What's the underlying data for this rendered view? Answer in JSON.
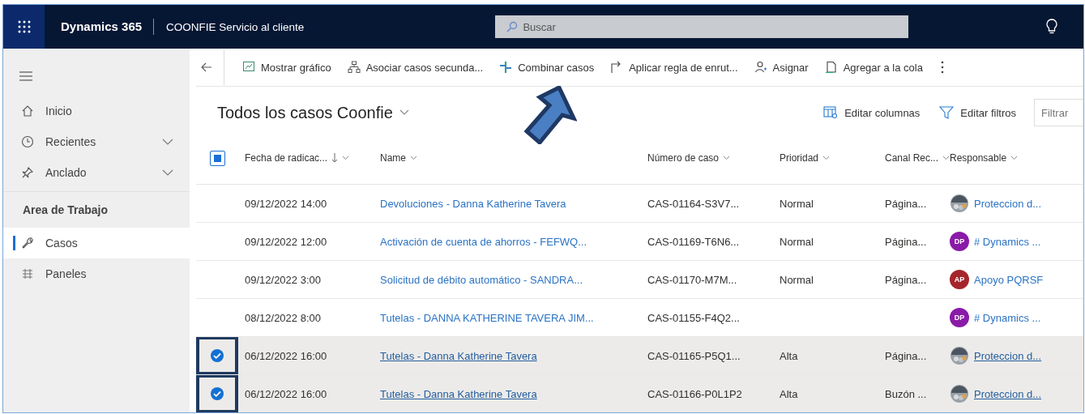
{
  "topbar": {
    "app_name": "Dynamics 365",
    "area": "COONFIE Servicio al cliente",
    "search": {
      "placeholder": "Buscar"
    }
  },
  "sidebar": {
    "items": [
      {
        "label": "Inicio",
        "kind": "home",
        "expandable": false,
        "selected": false
      },
      {
        "label": "Recientes",
        "kind": "clock",
        "expandable": true,
        "selected": false
      },
      {
        "label": "Anclado",
        "kind": "pin",
        "expandable": true,
        "selected": false
      }
    ],
    "section": "Area de Trabajo",
    "section_items": [
      {
        "label": "Casos",
        "kind": "wrench",
        "selected": true
      },
      {
        "label": "Paneles",
        "kind": "panels",
        "selected": false
      }
    ]
  },
  "commands": [
    {
      "label": "Mostrar gráfico",
      "kind": "chart"
    },
    {
      "label": "Asociar casos secunda...",
      "kind": "tree"
    },
    {
      "label": "Combinar casos",
      "kind": "merge"
    },
    {
      "label": "Aplicar regla de enrut...",
      "kind": "route"
    },
    {
      "label": "Asignar",
      "kind": "person"
    },
    {
      "label": "Agregar a la cola",
      "kind": "queue"
    }
  ],
  "view": {
    "title": "Todos los casos Coonfie",
    "actions": [
      {
        "label": "Editar columnas",
        "kind": "columns"
      },
      {
        "label": "Editar filtros",
        "kind": "filter"
      }
    ],
    "filter": {
      "placeholder": "Filtrar"
    }
  },
  "table": {
    "select_all": {
      "partial": true
    },
    "columns": [
      {
        "label": "Fecha de radicac...",
        "sorted": true
      },
      {
        "label": "Name",
        "sorted": false
      },
      {
        "label": "Número de caso",
        "sorted": false
      },
      {
        "label": "Prioridad",
        "sorted": false
      },
      {
        "label": "Canal Rec...",
        "sorted": false
      },
      {
        "label": "Responsable",
        "sorted": false
      }
    ],
    "rows": [
      {
        "date": "09/12/2022 14:00",
        "name": "Devoluciones - Danna Katherine Tavera",
        "number": "CAS-01164-S3V7...",
        "priority": "Normal",
        "channel": "Página...",
        "owner": {
          "kind": "image",
          "name": "Proteccion d..."
        },
        "selected": false
      },
      {
        "date": "09/12/2022 12:00",
        "name": "Activación de cuenta de ahorros - FEFWQ...",
        "number": "CAS-01169-T6N6...",
        "priority": "Normal",
        "channel": "Página...",
        "owner": {
          "kind": "initials",
          "initials": "DP",
          "color": "#8a1aa8",
          "name": "# Dynamics ..."
        },
        "selected": false
      },
      {
        "date": "09/12/2022 3:00",
        "name": "Solicitud de débito automático - SANDRA...",
        "number": "CAS-01170-M7M...",
        "priority": "Normal",
        "channel": "Página...",
        "owner": {
          "kind": "initials",
          "initials": "AP",
          "color": "#a4262c",
          "name": "Apoyo PQRSF"
        },
        "selected": false
      },
      {
        "date": "08/12/2022 8:00",
        "name": "Tutelas - DANNA KATHERINE TAVERA JIM...",
        "number": "CAS-01155-F4Q2...",
        "owner": {
          "kind": "initials",
          "initials": "DP",
          "color": "#8a1aa8",
          "name": "# Dynamics ..."
        },
        "selected": false
      },
      {
        "date": "06/12/2022 16:00",
        "name": "Tutelas - Danna Katherine Tavera",
        "number": "CAS-01165-P5Q1...",
        "priority": "Alta",
        "channel": "Página...",
        "owner": {
          "kind": "image",
          "name": "Proteccion d..."
        },
        "selected": true
      },
      {
        "date": "06/12/2022 16:00",
        "name": "Tutelas - Danna Katherine Tavera",
        "number": "CAS-01166-P0L1P2",
        "priority": "Alta",
        "channel": "Buzón ...",
        "owner": {
          "kind": "image",
          "name": "Proteccion d..."
        },
        "selected": true
      }
    ]
  }
}
